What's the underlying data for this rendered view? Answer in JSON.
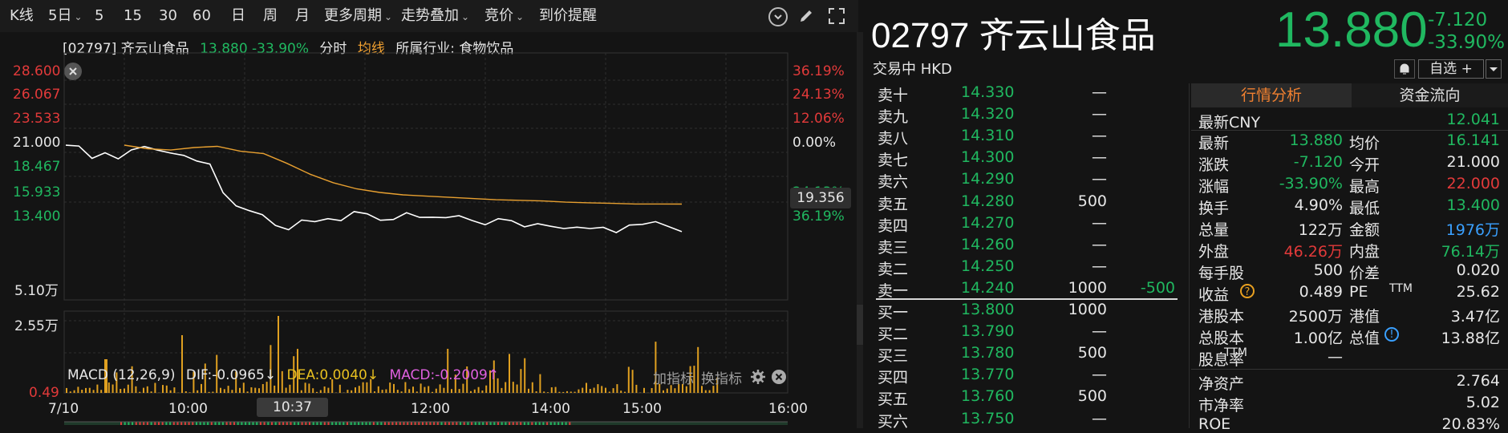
{
  "toolbar": {
    "items": [
      {
        "label": "K线",
        "dropdown": false
      },
      {
        "label": "5日",
        "dropdown": true
      },
      {
        "label": "5",
        "dropdown": false
      },
      {
        "label": "15",
        "dropdown": false
      },
      {
        "label": "30",
        "dropdown": false
      },
      {
        "label": "60",
        "dropdown": false
      },
      {
        "label": "日",
        "dropdown": false
      },
      {
        "label": "周",
        "dropdown": false
      },
      {
        "label": "月",
        "dropdown": false
      },
      {
        "label": "更多周期",
        "dropdown": true
      },
      {
        "label": "走势叠加",
        "dropdown": true
      },
      {
        "label": "竞价",
        "dropdown": true
      },
      {
        "label": "到价提醒",
        "dropdown": false
      }
    ]
  },
  "chart_header": {
    "code": "[02797] 齐云山食品",
    "price": "13.880",
    "change_pct": "-33.90%",
    "mode": "分时",
    "avg_label": "均线",
    "industry": "所属行业: 食物饮品"
  },
  "price_axis": {
    "left": [
      "28.600",
      "26.067",
      "23.533",
      "21.000",
      "18.467",
      "15.933",
      "13.400"
    ],
    "right": [
      "36.19%",
      "24.13%",
      "12.06%",
      "0.00%",
      "",
      "24.13%",
      "36.19%"
    ],
    "crosshair_value": "19.356"
  },
  "volume_axis": {
    "top": "5.10万",
    "mid": "2.55万"
  },
  "macd": {
    "label": "MACD (12,26,9)",
    "dif": "DIF:-0.0965",
    "dea": "DEA:0.0040",
    "macd": "MACD:-0.2009",
    "add_indicator": "加指标",
    "change_indicator": "换指标",
    "low_value": "0.49"
  },
  "time_axis": [
    "7/10",
    "10:00",
    "10:37",
    "12:00",
    "14:00",
    "15:00",
    "16:00"
  ],
  "stock": {
    "code": "02797",
    "name": "齐云山食品",
    "price": "13.880",
    "change": "-7.120",
    "change_pct": "-33.90%",
    "status": "交易中 HKD",
    "watchlist": "自选 +"
  },
  "order_book": {
    "asks": [
      {
        "label": "卖十",
        "price": "14.330",
        "vol": "—",
        "diff": ""
      },
      {
        "label": "卖九",
        "price": "14.320",
        "vol": "—",
        "diff": ""
      },
      {
        "label": "卖八",
        "price": "14.310",
        "vol": "—",
        "diff": ""
      },
      {
        "label": "卖七",
        "price": "14.300",
        "vol": "—",
        "diff": ""
      },
      {
        "label": "卖六",
        "price": "14.290",
        "vol": "—",
        "diff": ""
      },
      {
        "label": "卖五",
        "price": "14.280",
        "vol": "500",
        "diff": ""
      },
      {
        "label": "卖四",
        "price": "14.270",
        "vol": "—",
        "diff": ""
      },
      {
        "label": "卖三",
        "price": "14.260",
        "vol": "—",
        "diff": ""
      },
      {
        "label": "卖二",
        "price": "14.250",
        "vol": "—",
        "diff": ""
      },
      {
        "label": "卖一",
        "price": "14.240",
        "vol": "1000",
        "diff": "-500"
      }
    ],
    "bids": [
      {
        "label": "买一",
        "price": "13.800",
        "vol": "1000",
        "diff": ""
      },
      {
        "label": "买二",
        "price": "13.790",
        "vol": "—",
        "diff": ""
      },
      {
        "label": "买三",
        "price": "13.780",
        "vol": "500",
        "diff": ""
      },
      {
        "label": "买四",
        "price": "13.770",
        "vol": "—",
        "diff": ""
      },
      {
        "label": "买五",
        "price": "13.760",
        "vol": "500",
        "diff": ""
      },
      {
        "label": "买六",
        "price": "13.750",
        "vol": "—",
        "diff": ""
      }
    ]
  },
  "tabs": {
    "analysis": "行情分析",
    "flow": "资金流向"
  },
  "quote": {
    "cny_label": "最新CNY",
    "cny_value": "12.041",
    "rows": [
      {
        "l1": "最新",
        "v1": "13.880",
        "c1": "green",
        "l2": "均价",
        "v2": "16.141",
        "c2": "green"
      },
      {
        "l1": "涨跌",
        "v1": "-7.120",
        "c1": "green",
        "l2": "今开",
        "v2": "21.000",
        "c2": "white"
      },
      {
        "l1": "涨幅",
        "v1": "-33.90%",
        "c1": "green",
        "l2": "最高",
        "v2": "22.000",
        "c2": "red"
      },
      {
        "l1": "换手",
        "v1": "4.90%",
        "c1": "white",
        "l2": "最低",
        "v2": "13.400",
        "c2": "green"
      },
      {
        "l1": "总量",
        "v1": "122万",
        "c1": "white",
        "l2": "金额",
        "v2": "1976万",
        "c2": "cyan"
      },
      {
        "l1": "外盘",
        "v1": "46.26万",
        "c1": "red",
        "l2": "内盘",
        "v2": "76.14万",
        "c2": "green"
      },
      {
        "l1": "每手股",
        "v1": "500",
        "c1": "white",
        "l2": "价差",
        "v2": "0.020",
        "c2": "white"
      },
      {
        "l1": "收益",
        "v1": "0.489",
        "c1": "white",
        "l2": "PE",
        "v2": "25.62",
        "c2": "white"
      },
      {
        "l1": "港股本",
        "v1": "2500万",
        "c1": "white",
        "l2": "港值",
        "v2": "3.47亿",
        "c2": "white"
      },
      {
        "l1": "总股本",
        "v1": "1.00亿",
        "c1": "white",
        "l2": "总值",
        "v2": "13.88亿",
        "c2": "white"
      },
      {
        "l1": "股息率",
        "v1": "—",
        "c1": "white",
        "l2": "",
        "v2": "",
        "c2": "white"
      }
    ],
    "ttm1": "TTM",
    "ttm2": "TTM",
    "extra": [
      {
        "l": "净资产",
        "v": "2.764"
      },
      {
        "l": "市净率",
        "v": "5.02"
      },
      {
        "l": "ROE",
        "v": "20.83%"
      }
    ]
  },
  "colors": {
    "up": "#e23a3a",
    "down": "#20b860",
    "price_line": "#ffffff",
    "avg_line": "#e8a030",
    "volume": "#e0a020",
    "cyan": "#3aa0ff"
  }
}
